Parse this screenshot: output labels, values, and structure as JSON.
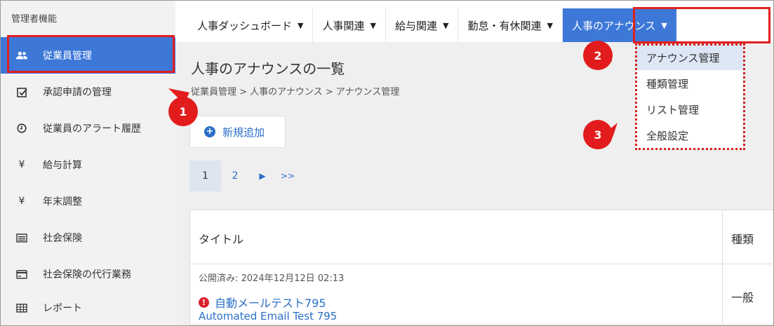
{
  "sidebar": {
    "header": "管理者機能",
    "items": [
      {
        "label": "従業員管理",
        "icon": "users-icon",
        "active": true
      },
      {
        "label": "承認申請の管理",
        "icon": "checkbox-icon"
      },
      {
        "label": "従業員のアラート履歴",
        "icon": "clock-icon"
      },
      {
        "label": "給与計算",
        "icon": "yen-icon"
      },
      {
        "label": "年末調整",
        "icon": "yen-icon"
      },
      {
        "label": "社会保険",
        "icon": "list-card-icon"
      },
      {
        "label": "社会保険の代行業務",
        "icon": "credit-card-icon"
      },
      {
        "label": "レポート",
        "icon": "table-icon"
      }
    ]
  },
  "topnav": {
    "items": [
      {
        "label": "人事ダッシュボード"
      },
      {
        "label": "人事関連"
      },
      {
        "label": "給与関連"
      },
      {
        "label": "勤怠・有休関連"
      },
      {
        "label": "人事のアナウンス",
        "active": true
      }
    ]
  },
  "dropdown": {
    "items": [
      "アナウンス管理",
      "種類管理",
      "リスト管理",
      "全般設定"
    ]
  },
  "main": {
    "title": "人事のアナウンスの一覧",
    "breadcrumb": "従業員管理 > 人事のアナウンス > アナウンス管理",
    "add_button": "新規追加",
    "pager": {
      "current": "1",
      "next_page": "2",
      "next": "▶",
      "last": ">>"
    }
  },
  "table": {
    "headers": {
      "title": "タイトル",
      "type": "種類"
    },
    "rows": [
      {
        "published": "公開済み: 2024年12月12日 02:13",
        "title_ja": "自動メールテスト795",
        "title_en": "Automated Email Test 795",
        "type": "一般"
      }
    ]
  },
  "callouts": [
    "1",
    "2",
    "3"
  ],
  "colors": {
    "accent": "#3d78d8",
    "highlight": "#e02020",
    "link": "#2a6fc7"
  }
}
